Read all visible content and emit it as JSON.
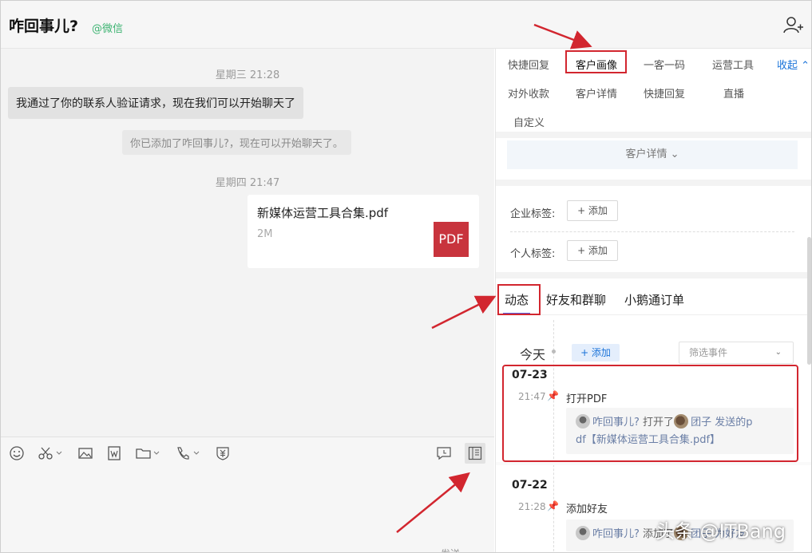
{
  "header": {
    "title": "咋回事儿?",
    "source": "@微信"
  },
  "chat": {
    "time1": "星期三 21:28",
    "message1": "我通过了你的联系人验证请求，现在我们可以开始聊天了",
    "system": "你已添加了咋回事儿?，现在可以开始聊天了。",
    "time2": "星期四 21:47",
    "file": {
      "name": "新媒体运营工具合集.pdf",
      "size": "2M",
      "badge": "PDF"
    }
  },
  "toolbar": {
    "icons": [
      "smiley-icon",
      "scissors-icon",
      "image-icon",
      "word-icon",
      "folder-icon",
      "phone-icon",
      "money-icon",
      "chat-history-icon",
      "sidebar-icon"
    ]
  },
  "right_panel": {
    "quick_tabs": [
      "快捷回复",
      "客户画像",
      "一客一码",
      "运营工具",
      "对外收款",
      "客户详情",
      "快捷回复",
      "直播",
      "自定义"
    ],
    "collapse": "收起",
    "detail_label": "客户详情",
    "enterprise_tag_label": "企业标签:",
    "personal_tag_label": "个人标签:",
    "add_label": "+ 添加",
    "tabs": [
      "动态",
      "好友和群聊",
      "小鹅通订单"
    ],
    "today": "今天",
    "add_event": "+ 添加",
    "filter_placeholder": "筛选事件",
    "events": [
      {
        "date": "07-23",
        "time": "21:47",
        "title": "打开PDF",
        "line1_user": "咋回事儿?",
        "line1_mid": "打开了",
        "line1_user2": "团子",
        "line1_end": "发送的p",
        "line2": "df【新媒体运营工具合集.pdf】"
      },
      {
        "date": "07-22",
        "time": "21:28",
        "title": "添加好友",
        "line1_user": "咋回事儿?",
        "line1_mid": "添加了",
        "line1_user2": "团子",
        "line1_end": "为好友"
      }
    ]
  },
  "input": {
    "hint": "发送"
  },
  "watermark": "头条 @ITBang",
  "colors": {
    "annotation_red": "#d2262f",
    "link_blue": "#1a73d9",
    "pdf_red": "#c8343d"
  }
}
